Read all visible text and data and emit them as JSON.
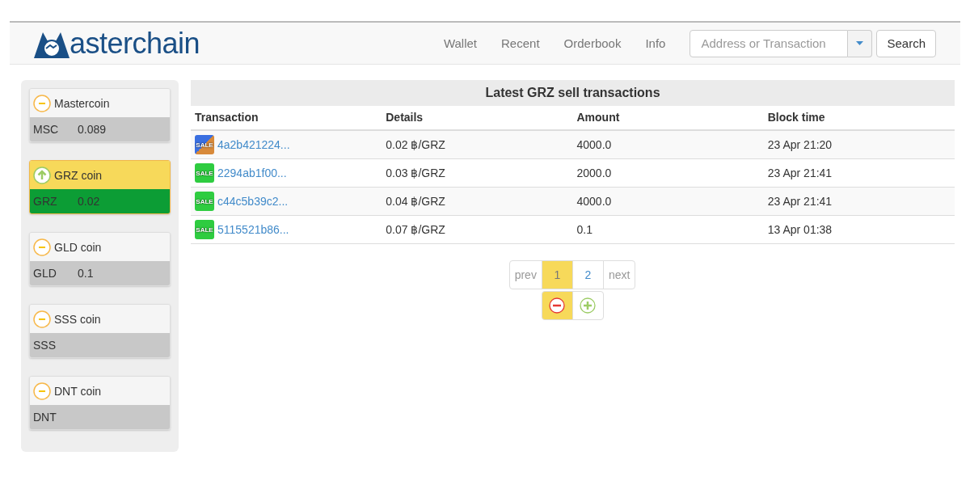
{
  "header": {
    "logo_text": "asterchain",
    "nav": [
      {
        "label": "Wallet",
        "selected": false
      },
      {
        "label": "Recent",
        "selected": false
      },
      {
        "label": "Orderbook",
        "selected": false
      },
      {
        "label": "Info",
        "selected": false
      }
    ],
    "search": {
      "placeholder": "Address or Transaction",
      "button": "Search"
    }
  },
  "sidebar": {
    "coins": [
      {
        "name": "Mastercoin",
        "symbol": "MSC",
        "balance": "0.089",
        "selected": false
      },
      {
        "name": "GRZ coin",
        "symbol": "GRZ",
        "balance": "0.02",
        "selected": true
      },
      {
        "name": "GLD coin",
        "symbol": "GLD",
        "balance": "0.1",
        "selected": false
      },
      {
        "name": "SSS coin",
        "symbol": "SSS",
        "selected": false
      },
      {
        "name": "DNT coin",
        "symbol": "DNT",
        "selected": false
      }
    ]
  },
  "table": {
    "title": "Latest GRZ sell transactions",
    "columns": [
      "Transaction",
      "Details",
      "Amount",
      "Block time"
    ],
    "rows": [
      {
        "badge": "SALE",
        "kind": "pending",
        "tx": "4a2b421224...",
        "details": "0.02 ฿/GRZ",
        "amount": "4000.0",
        "time": "23 Apr 21:20"
      },
      {
        "badge": "SALE",
        "kind": "confirmed",
        "tx": "2294ab1f00...",
        "details": "0.03 ฿/GRZ",
        "amount": "2000.0",
        "time": "23 Apr 21:41"
      },
      {
        "badge": "SALE",
        "kind": "confirmed",
        "tx": "c44c5b39c2...",
        "details": "0.04 ฿/GRZ",
        "amount": "4000.0",
        "time": "23 Apr 21:41"
      },
      {
        "badge": "SALE",
        "kind": "confirmed",
        "tx": "5115521b86...",
        "details": "0.07 ฿/GRZ",
        "amount": "0.1",
        "time": "13 Apr 01:38"
      }
    ]
  },
  "pagination": {
    "prev": {
      "label": "prev",
      "disabled": true
    },
    "pages": [
      {
        "label": "1",
        "selected": true
      },
      {
        "label": "2",
        "selected": false
      }
    ],
    "next": {
      "label": "next",
      "disabled": true
    }
  },
  "filters": [
    {
      "kind": "minus",
      "selected": true
    },
    {
      "kind": "plus",
      "selected": false
    }
  ]
}
